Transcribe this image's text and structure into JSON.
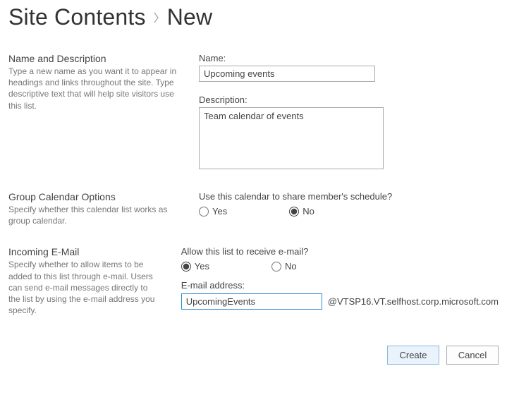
{
  "header": {
    "parent": "Site Contents",
    "current": "New"
  },
  "sections": {
    "nameDesc": {
      "title": "Name and Description",
      "desc": "Type a new name as you want it to appear in headings and links throughout the site. Type descriptive text that will help site visitors use this list.",
      "nameLabel": "Name:",
      "nameValue": "Upcoming events",
      "descLabel": "Description:",
      "descValue": "Team calendar of events"
    },
    "groupCal": {
      "title": "Group Calendar Options",
      "desc": "Specify whether this calendar list works as group calendar.",
      "question": "Use this calendar to share member's schedule?",
      "yes": "Yes",
      "no": "No",
      "selected": "no"
    },
    "email": {
      "title": "Incoming E-Mail",
      "desc": "Specify whether to allow items to be added to this list through e-mail. Users can send e-mail messages directly to the list by using the e-mail address you specify.",
      "question": "Allow this list to receive e-mail?",
      "yes": "Yes",
      "no": "No",
      "selected": "yes",
      "addrLabel": "E-mail address:",
      "addrValue": "UpcomingEvents",
      "addrDomain": "@VTSP16.VT.selfhost.corp.microsoft.com"
    }
  },
  "buttons": {
    "create": "Create",
    "cancel": "Cancel"
  }
}
